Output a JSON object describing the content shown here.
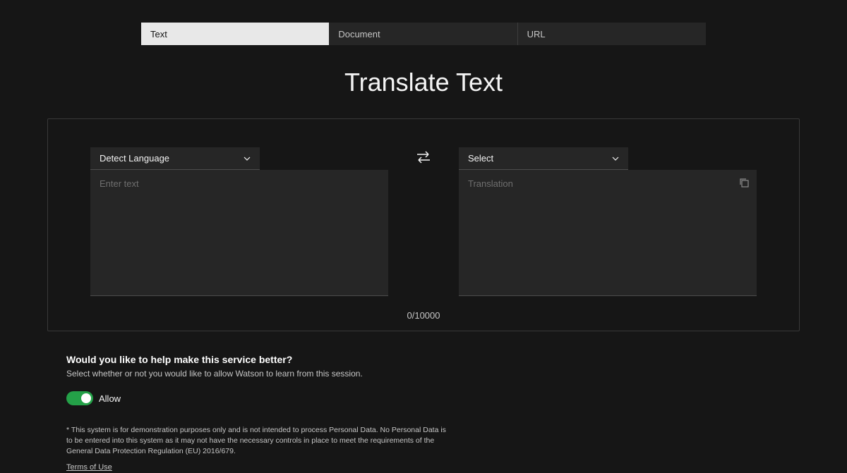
{
  "tabs": {
    "text": "Text",
    "document": "Document",
    "url": "URL"
  },
  "heading": "Translate Text",
  "source": {
    "dropdown": "Detect Language",
    "placeholder": "Enter text"
  },
  "target": {
    "dropdown": "Select",
    "placeholder": "Translation"
  },
  "counter": "0/10000",
  "feedback": {
    "title": "Would you like to help make this service better?",
    "subtitle": "Select whether or not you would like to allow Watson to learn from this session.",
    "toggle_label": "Allow"
  },
  "disclaimer": "* This system is for demonstration purposes only and is not intended to process Personal Data. No Personal Data is to be entered into this system as it may not have the necessary controls in place to meet the requirements of the General Data Protection Regulation (EU) 2016/679.",
  "terms": "Terms of Use"
}
